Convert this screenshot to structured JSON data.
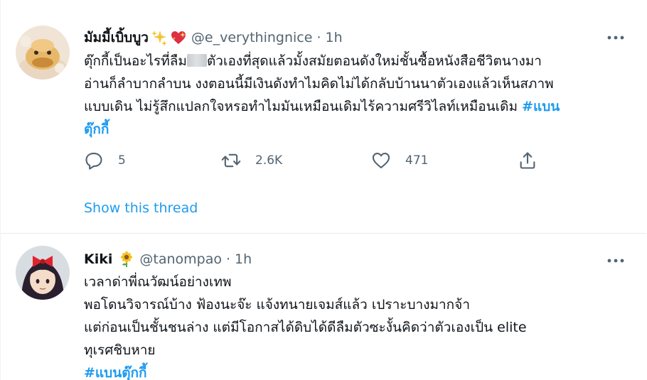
{
  "tweets": [
    {
      "display_name": "มัมมี้เบิ้บบูว",
      "emoji": [
        "sparkles-emoji",
        "sparkling-heart-emoji"
      ],
      "handle": "@e_verythingnice",
      "separator": "·",
      "time": "1h",
      "body_lines": [
        {
          "pre": "ตุ๊กกี้เป็นอะไรที่ลืม",
          "post": "ตัวเองที่สุดแล้วมั้งสมัยตอนดังใหม่ชั้นซื้อหนังสือชีวิตนางมา"
        },
        "อ่านก็ลำบากลำบน งงตอนนี้มีเงินดังทำไมคิดไม่ได้กลับบ้านนาตัวเองแล้วเห็นสภาพ",
        {
          "pre": "แบบเดิน ไม่รู้สึกแปลกใจหรอทำไมมันเหมือนเดิมไร้ความศรีวิไลท์เหมือนเดิม ",
          "tag": "#แบน"
        },
        {
          "tag": "ตุ๊กกี้"
        }
      ],
      "actions": {
        "reply_count": "5",
        "retweet_count": "2.6K",
        "like_count": "471"
      },
      "show_thread": "Show this thread"
    },
    {
      "display_name": "Kiki",
      "emoji": [
        "sunflower-emoji"
      ],
      "handle": "@tanompao",
      "separator": "·",
      "time": "1h",
      "body_lines": [
        "เวลาด่าพี่ณวัฒน์อย่างเทพ",
        "พอโดนวิจารณ์บ้าง ฟ้องนะจ๊ะ แจ้งทนายเจมส์แล้ว เปราะบางมากจ้า",
        "แต่ก่อนเป็นชั้นชนล่าง แต่มีโอกาสได้ดิบได้ดีลืมตัวซะงั้นคิดว่าตัวเองเป็น elite",
        "ทุเรศชิบหาย",
        {
          "tag": "#แบนตุ๊กกี้"
        }
      ]
    }
  ],
  "colors": {
    "accent": "#1d9bf0",
    "secondary_text": "#536471",
    "primary_text": "#0f1419",
    "divider": "#e6ecf0"
  }
}
